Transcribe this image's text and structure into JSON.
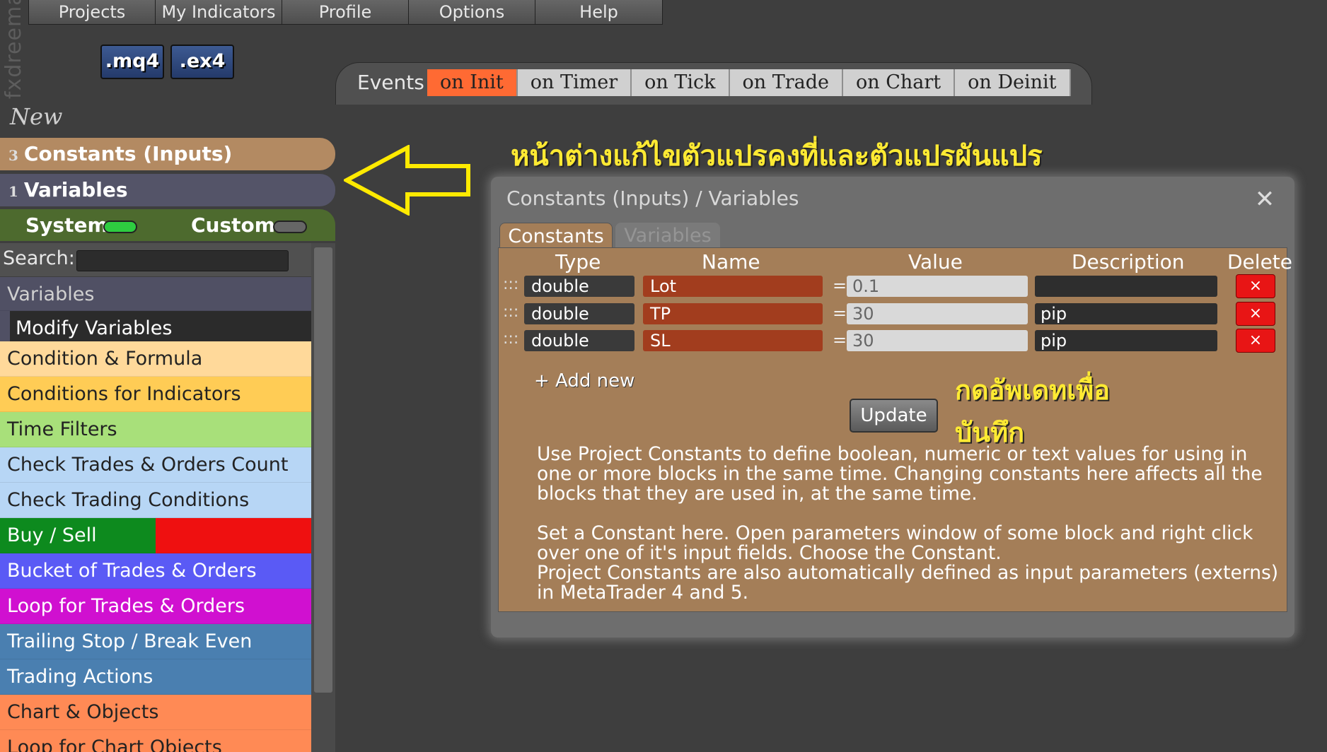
{
  "app": {
    "logo": "fxdreema"
  },
  "menu": [
    "Projects",
    "My Indicators",
    "Profile",
    "Options",
    "Help"
  ],
  "files": {
    "mq4": ".mq4",
    "ex4": ".ex4"
  },
  "events": {
    "label": "Events",
    "tabs": [
      "on Init",
      "on Timer",
      "on Tick",
      "on Trade",
      "on Chart",
      "on Deinit"
    ],
    "active": "on Init"
  },
  "sidebar": {
    "new_label": "New",
    "constants": {
      "count": "3",
      "label": "Constants (Inputs)"
    },
    "variables": {
      "count": "1",
      "label": "Variables"
    },
    "system_label": "System",
    "custom_label": "Custom",
    "search_label": "Search:",
    "category": "Variables",
    "modify": "Modify Variables",
    "items": [
      "Condition & Formula",
      "Conditions for Indicators",
      "Time Filters",
      "Check Trades & Orders Count",
      "Check Trading Conditions",
      "Buy / Sell",
      "Bucket of Trades & Orders",
      "Loop for Trades & Orders",
      "Trailing Stop / Break Even",
      "Trading Actions",
      "Chart & Objects",
      "Loop for Chart Objects"
    ]
  },
  "annotation": {
    "title": "หน้าต่างแก้ไขตัวแปรคงที่และตัวแปรผันแปร",
    "update_note": "กดอัพเดทเพื่อบันทึก"
  },
  "dialog": {
    "title": "Constants (Inputs) / Variables",
    "tabs": {
      "constants": "Constants",
      "variables": "Variables"
    },
    "columns": {
      "type": "Type",
      "name": "Name",
      "value": "Value",
      "description": "Description",
      "delete": "Delete"
    },
    "rows": [
      {
        "type": "double",
        "name": "Lot",
        "value": "0.1",
        "description": ""
      },
      {
        "type": "double",
        "name": "TP",
        "value": "30",
        "description": "pip"
      },
      {
        "type": "double",
        "name": "SL",
        "value": "30",
        "description": "pip"
      }
    ],
    "drag_glyph": ":::",
    "eq": "=",
    "delete_glyph": "×",
    "add_new": "+ Add new",
    "update": "Update",
    "help": [
      "Use Project Constants to define boolean, numeric or text values for using in one or more blocks in the same time. Changing constants here affects all the blocks that they are used in, at the same time.",
      "Set a Constant here. Open parameters window of some block and right click over one of it's input fields. Choose the Constant.",
      "Project Constants are also automatically defined as input parameters (externs) in MetaTrader 4 and 5."
    ],
    "close_glyph": "✕"
  }
}
